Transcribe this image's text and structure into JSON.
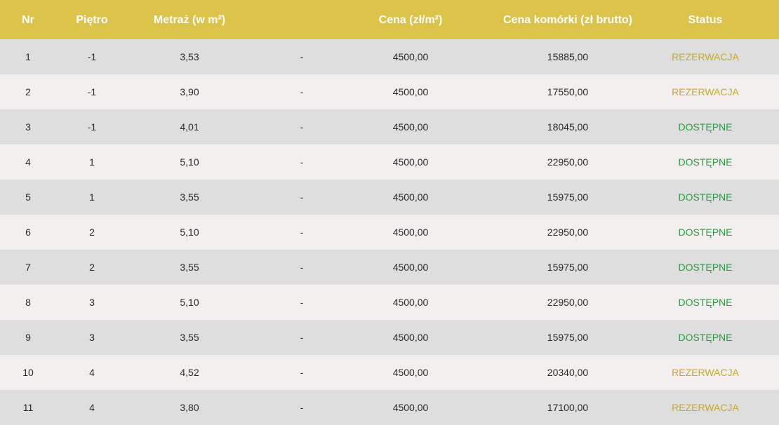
{
  "header": {
    "nr": "Nr",
    "pietro": "Piętro",
    "metraz": "Metraż (w m²)",
    "empty": "",
    "cena": "Cena (zł/m²)",
    "cena_komorki": "Cena komórki (zł brutto)",
    "status": "Status"
  },
  "colors": {
    "header_bg": "#dcc34a",
    "row_even": "#dedede",
    "row_odd": "#f2efee",
    "status_reserved": "#c8a82e",
    "status_available": "#22a13c"
  },
  "rows": [
    {
      "nr": "1",
      "pietro": "-1",
      "metraz": "3,53",
      "extra": "-",
      "cena": "4500,00",
      "cena_komorki": "15885,00",
      "status": "REZERWACJA",
      "status_type": "reserved"
    },
    {
      "nr": "2",
      "pietro": "-1",
      "metraz": "3,90",
      "extra": "-",
      "cena": "4500,00",
      "cena_komorki": "17550,00",
      "status": "REZERWACJA",
      "status_type": "reserved"
    },
    {
      "nr": "3",
      "pietro": "-1",
      "metraz": "4,01",
      "extra": "-",
      "cena": "4500,00",
      "cena_komorki": "18045,00",
      "status": "DOSTĘPNE",
      "status_type": "available"
    },
    {
      "nr": "4",
      "pietro": "1",
      "metraz": "5,10",
      "extra": "-",
      "cena": "4500,00",
      "cena_komorki": "22950,00",
      "status": "DOSTĘPNE",
      "status_type": "available"
    },
    {
      "nr": "5",
      "pietro": "1",
      "metraz": "3,55",
      "extra": "-",
      "cena": "4500,00",
      "cena_komorki": "15975,00",
      "status": "DOSTĘPNE",
      "status_type": "available"
    },
    {
      "nr": "6",
      "pietro": "2",
      "metraz": "5,10",
      "extra": "-",
      "cena": "4500,00",
      "cena_komorki": "22950,00",
      "status": "DOSTĘPNE",
      "status_type": "available"
    },
    {
      "nr": "7",
      "pietro": "2",
      "metraz": "3,55",
      "extra": "-",
      "cena": "4500,00",
      "cena_komorki": "15975,00",
      "status": "DOSTĘPNE",
      "status_type": "available"
    },
    {
      "nr": "8",
      "pietro": "3",
      "metraz": "5,10",
      "extra": "-",
      "cena": "4500,00",
      "cena_komorki": "22950,00",
      "status": "DOSTĘPNE",
      "status_type": "available"
    },
    {
      "nr": "9",
      "pietro": "3",
      "metraz": "3,55",
      "extra": "-",
      "cena": "4500,00",
      "cena_komorki": "15975,00",
      "status": "DOSTĘPNE",
      "status_type": "available"
    },
    {
      "nr": "10",
      "pietro": "4",
      "metraz": "4,52",
      "extra": "-",
      "cena": "4500,00",
      "cena_komorki": "20340,00",
      "status": "REZERWACJA",
      "status_type": "reserved"
    },
    {
      "nr": "11",
      "pietro": "4",
      "metraz": "3,80",
      "extra": "-",
      "cena": "4500,00",
      "cena_komorki": "17100,00",
      "status": "REZERWACJA",
      "status_type": "reserved"
    }
  ]
}
